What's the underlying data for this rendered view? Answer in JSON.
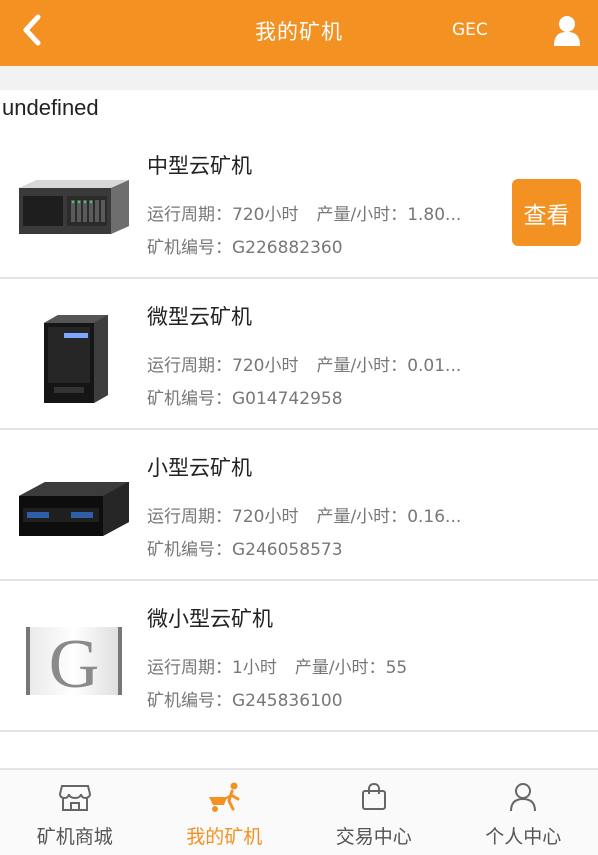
{
  "header": {
    "title": "我的矿机",
    "coin": "GEC",
    "back_icon": "chevron-left-icon",
    "user_icon": "user-icon"
  },
  "notice": "undefined",
  "miners": [
    {
      "name": "中型云矿机",
      "period_label": "运行周期：",
      "period": "720小时",
      "output_label": "产量/小时：",
      "output": "1.80...",
      "id_label": "矿机编号：",
      "id": "G226882360",
      "image": "rack-server",
      "button": "查看"
    },
    {
      "name": "微型云矿机",
      "period_label": "运行周期：",
      "period": "720小时",
      "output_label": "产量/小时：",
      "output": "0.01...",
      "id_label": "矿机编号：",
      "id": "G014742958",
      "image": "tower-pc"
    },
    {
      "name": "小型云矿机",
      "period_label": "运行周期：",
      "period": "720小时",
      "output_label": "产量/小时：",
      "output": "0.16...",
      "id_label": "矿机编号：",
      "id": "G246058573",
      "image": "flat-box"
    },
    {
      "name": "微小型云矿机",
      "period_label": "运行周期：",
      "period": "1小时",
      "output_label": "产量/小时：",
      "output": "55",
      "id_label": "矿机编号：",
      "id": "G245836100",
      "image": "g-logo"
    }
  ],
  "tabs": [
    {
      "label": "矿机商城",
      "icon": "shop-icon",
      "active": false
    },
    {
      "label": "我的矿机",
      "icon": "miner-icon",
      "active": true
    },
    {
      "label": "交易中心",
      "icon": "bag-icon",
      "active": false
    },
    {
      "label": "个人中心",
      "icon": "person-icon",
      "active": false
    }
  ],
  "colors": {
    "accent": "#f39222"
  }
}
